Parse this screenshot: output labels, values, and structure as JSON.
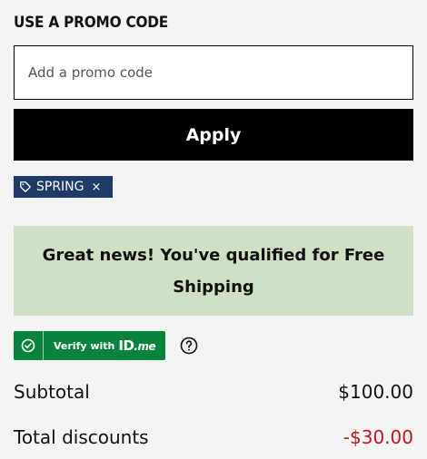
{
  "promo": {
    "heading": "USE A PROMO CODE",
    "input_placeholder": "Add a promo code",
    "input_value": "",
    "apply_label": "Apply",
    "applied_code": "SPRING",
    "remove_glyph": "×"
  },
  "banner": {
    "message": "Great news! You've qualified for Free Shipping"
  },
  "idme": {
    "verify_label": "Verify with",
    "logo_text": "ID",
    "logo_suffix": ".me"
  },
  "summary": {
    "subtotal_label": "Subtotal",
    "subtotal_value": "$100.00",
    "discounts_label": "Total discounts",
    "discounts_value": "-$30.00"
  },
  "colors": {
    "tag_bg": "#1e3a66",
    "banner_bg": "#cfe0c7",
    "idme_green": "#08833d",
    "discount_red": "#c0161d"
  },
  "icons": {
    "tag": "tag-icon",
    "check": "check-circle-icon",
    "help": "question-circle-icon"
  }
}
